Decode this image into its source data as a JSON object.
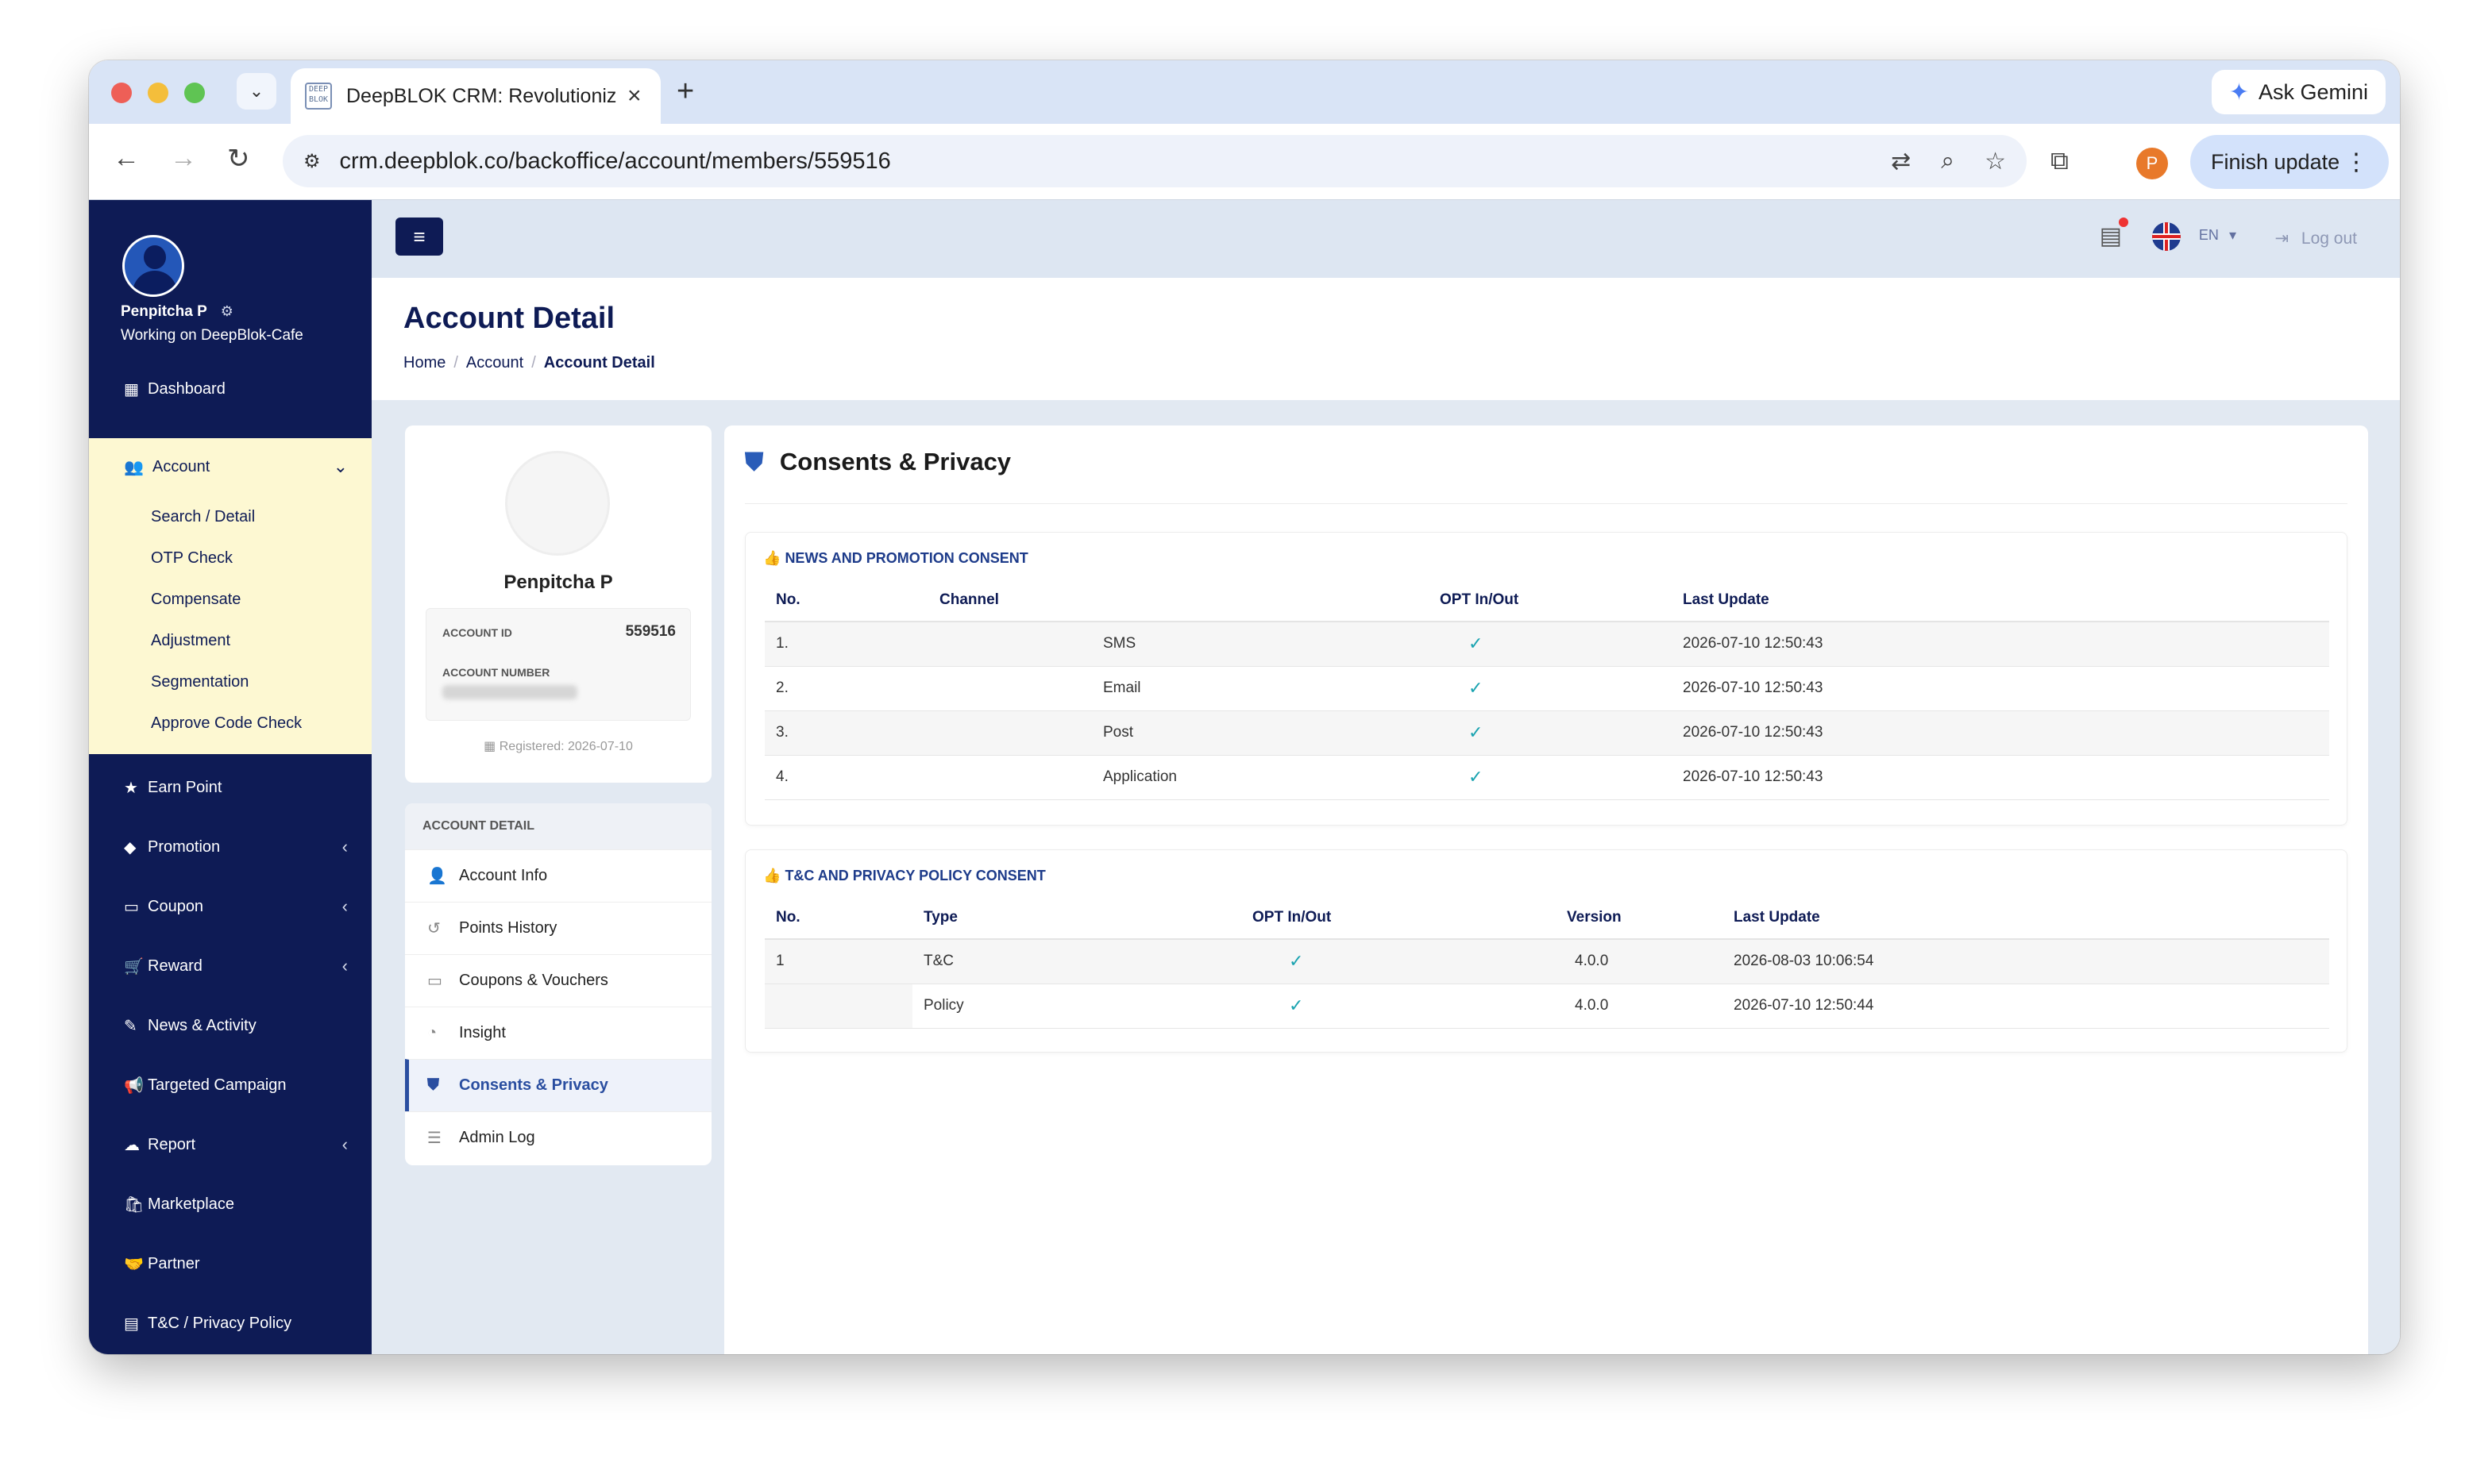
{
  "browser": {
    "tab_title": "DeepBLOK CRM: Revolutioniz",
    "tab_favicon_text": "DEEP BLOK",
    "url": "crm.deepblok.co/backoffice/account/members/559516",
    "gemini_label": "Ask Gemini",
    "profile_initial": "P",
    "finish_update_label": "Finish update"
  },
  "sidebar": {
    "user_name": "Penpitcha P",
    "working_on": "Working on DeepBlok-Cafe",
    "dashboard": "Dashboard",
    "account": {
      "label": "Account",
      "subitems": [
        "Search / Detail",
        "OTP Check",
        "Compensate",
        "Adjustment",
        "Segmentation",
        "Approve Code Check"
      ]
    },
    "items": [
      "Earn Point",
      "Promotion",
      "Coupon",
      "Reward",
      "News & Activity",
      "Targeted Campaign",
      "Report",
      "Marketplace",
      "Partner",
      "T&C / Privacy Policy"
    ]
  },
  "topbar": {
    "language": "EN",
    "logout": "Log out"
  },
  "header": {
    "title": "Account Detail",
    "breadcrumb": [
      "Home",
      "Account",
      "Account Detail"
    ]
  },
  "profile": {
    "name": "Penpitcha P",
    "account_id_label": "ACCOUNT ID",
    "account_id": "559516",
    "account_number_label": "ACCOUNT NUMBER",
    "registered": "Registered: 2026-07-10"
  },
  "detail_menu": {
    "heading": "ACCOUNT DETAIL",
    "items": [
      "Account Info",
      "Points History",
      "Coupons & Vouchers",
      "Insight",
      "Consents & Privacy",
      "Admin Log"
    ]
  },
  "consents": {
    "title": "Consents & Privacy",
    "news": {
      "title": "NEWS AND PROMOTION CONSENT",
      "headers": [
        "No.",
        "Channel",
        "OPT In/Out",
        "Last Update"
      ],
      "rows": [
        {
          "no": "1.",
          "channel": "SMS",
          "opt": "✓",
          "updated": "2026-07-10 12:50:43"
        },
        {
          "no": "2.",
          "channel": "Email",
          "opt": "✓",
          "updated": "2026-07-10 12:50:43"
        },
        {
          "no": "3.",
          "channel": "Post",
          "opt": "✓",
          "updated": "2026-07-10 12:50:43"
        },
        {
          "no": "4.",
          "channel": "Application",
          "opt": "✓",
          "updated": "2026-07-10 12:50:43"
        }
      ]
    },
    "tnc": {
      "title": "T&C AND PRIVACY POLICY CONSENT",
      "headers": [
        "No.",
        "Type",
        "OPT In/Out",
        "Version",
        "Last Update"
      ],
      "rows": [
        {
          "no": "1",
          "type": "T&C",
          "opt": "✓",
          "version": "4.0.0",
          "updated": "2026-08-03 10:06:54"
        },
        {
          "no": "",
          "type": "Policy",
          "opt": "✓",
          "version": "4.0.0",
          "updated": "2026-07-10 12:50:44"
        }
      ]
    }
  }
}
